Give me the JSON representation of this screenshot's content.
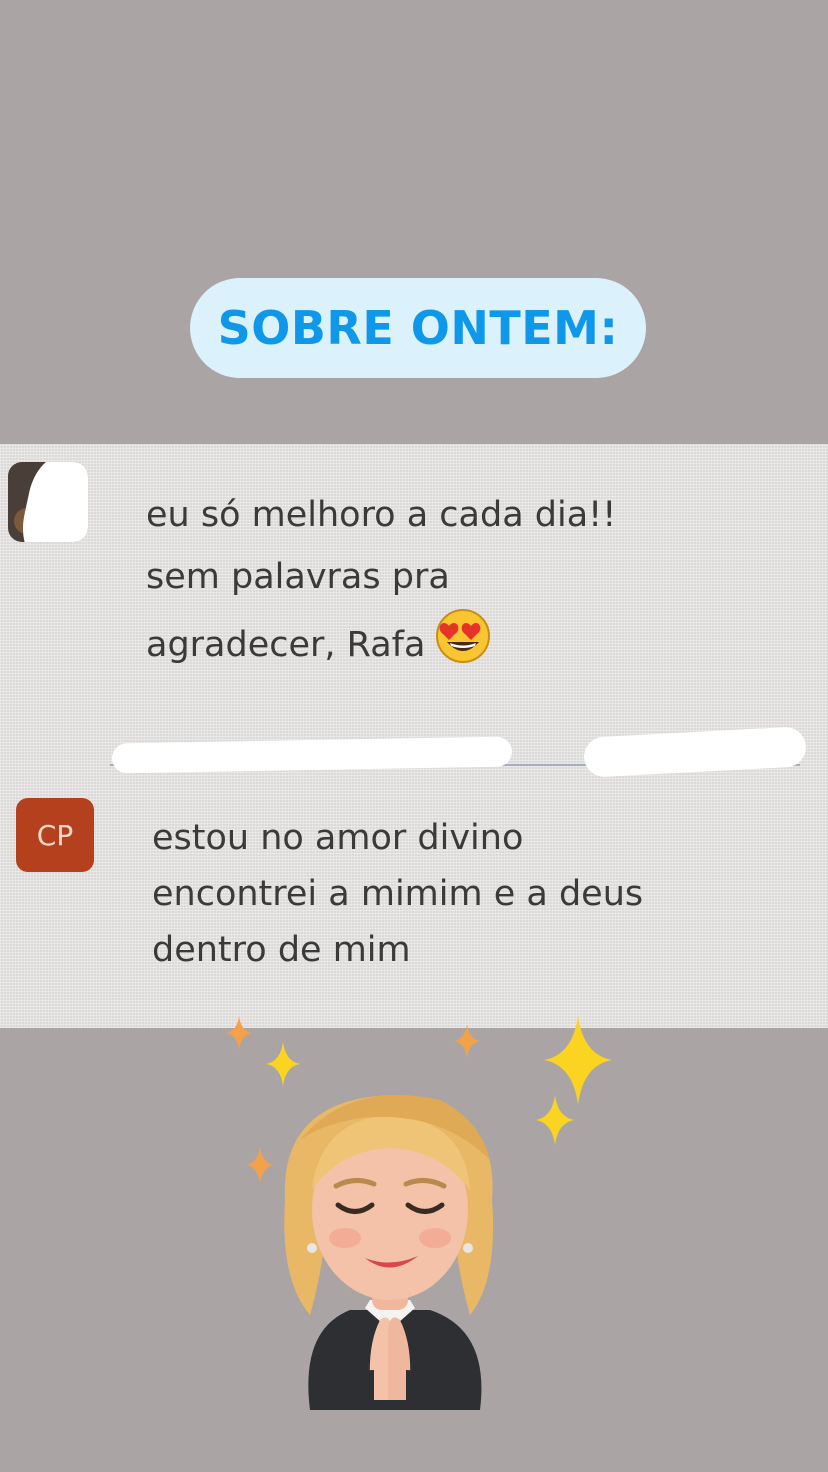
{
  "title": {
    "text": "SOBRE ONTEM:"
  },
  "messages": [
    {
      "avatar_initials": "",
      "lines": [
        "eu só melhoro a cada dia!!",
        "sem palavras pra",
        "agradecer, Rafa"
      ],
      "emoji": "heart-eyes-emoji"
    },
    {
      "avatar_initials": "CP",
      "lines": [
        "estou no amor divino",
        "encontrei a mimim e a deus",
        "dentro de mim"
      ]
    }
  ],
  "colors": {
    "background": "#aaa5a4",
    "title_pill": "#dbf1fb",
    "title_text": "#0f98ea",
    "avatar_cp": "#b4401d",
    "sparkle_yellow": "#fbd321",
    "sparkle_orange": "#f3a24a"
  },
  "stickers": [
    "sparkles-icon",
    "memoji-praying-hands"
  ]
}
